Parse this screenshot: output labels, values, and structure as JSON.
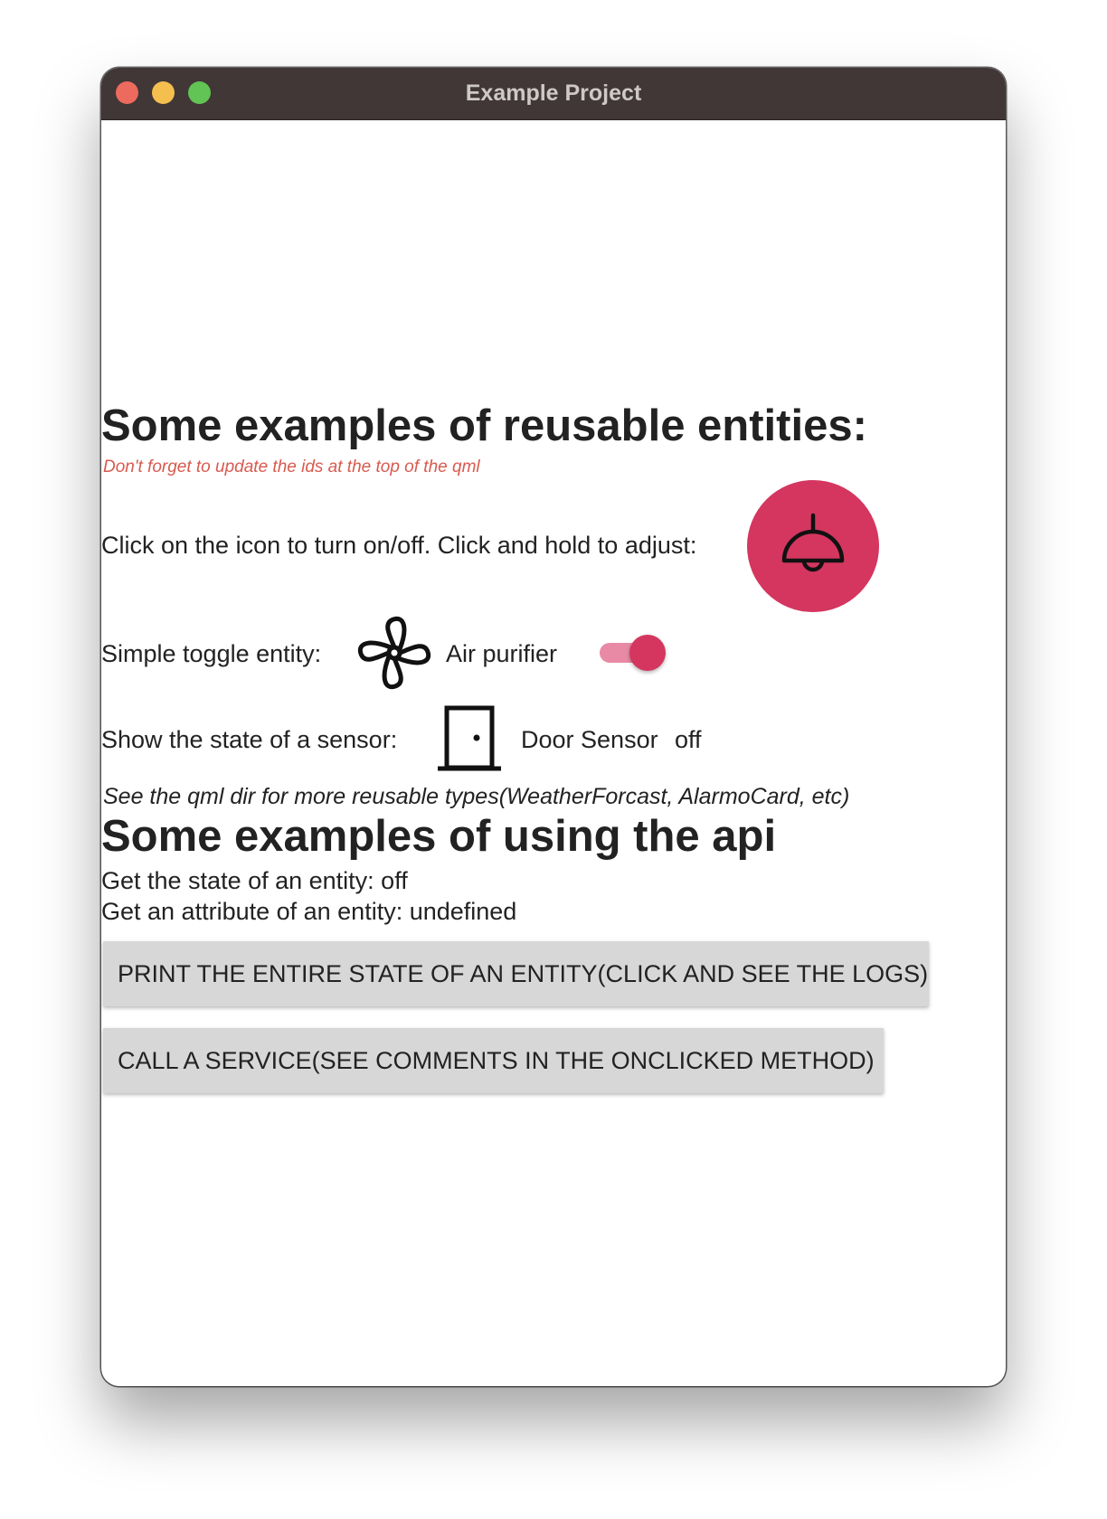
{
  "window": {
    "title": "Example Project"
  },
  "section_entities": {
    "heading": "Some examples of reusable entities:",
    "note": "Don't forget to update the ids at the top of the qml",
    "light_row": {
      "label": "Click on the icon to turn on/off. Click and hold to adjust:",
      "icon": "ceiling-light-icon",
      "color": "#d4365f"
    },
    "toggle_row": {
      "label": "Simple toggle entity:",
      "icon": "fan-icon",
      "entity_name": "Air purifier",
      "toggle_on": true
    },
    "sensor_row": {
      "label": "Show the state of a sensor:",
      "icon": "door-icon",
      "entity_name": "Door Sensor",
      "state": "off"
    },
    "footer_note": "See the qml dir for more reusable types(WeatherForcast, AlarmoCard, etc)"
  },
  "section_api": {
    "heading": "Some examples of using the api",
    "state_line": "Get the state of an entity: off",
    "attribute_line": "Get an attribute of an entity: undefined",
    "print_button": "PRINT THE ENTIRE STATE OF AN ENTITY(CLICK AND SEE THE LOGS)",
    "service_button": "CALL A SERVICE(SEE COMMENTS IN THE ONCLICKED METHOD)"
  },
  "colors": {
    "accent": "#d4365f",
    "accent_light": "#e88aa5",
    "note_red": "#d85a4f",
    "titlebar": "#413737",
    "button_bg": "#d7d7d7"
  }
}
